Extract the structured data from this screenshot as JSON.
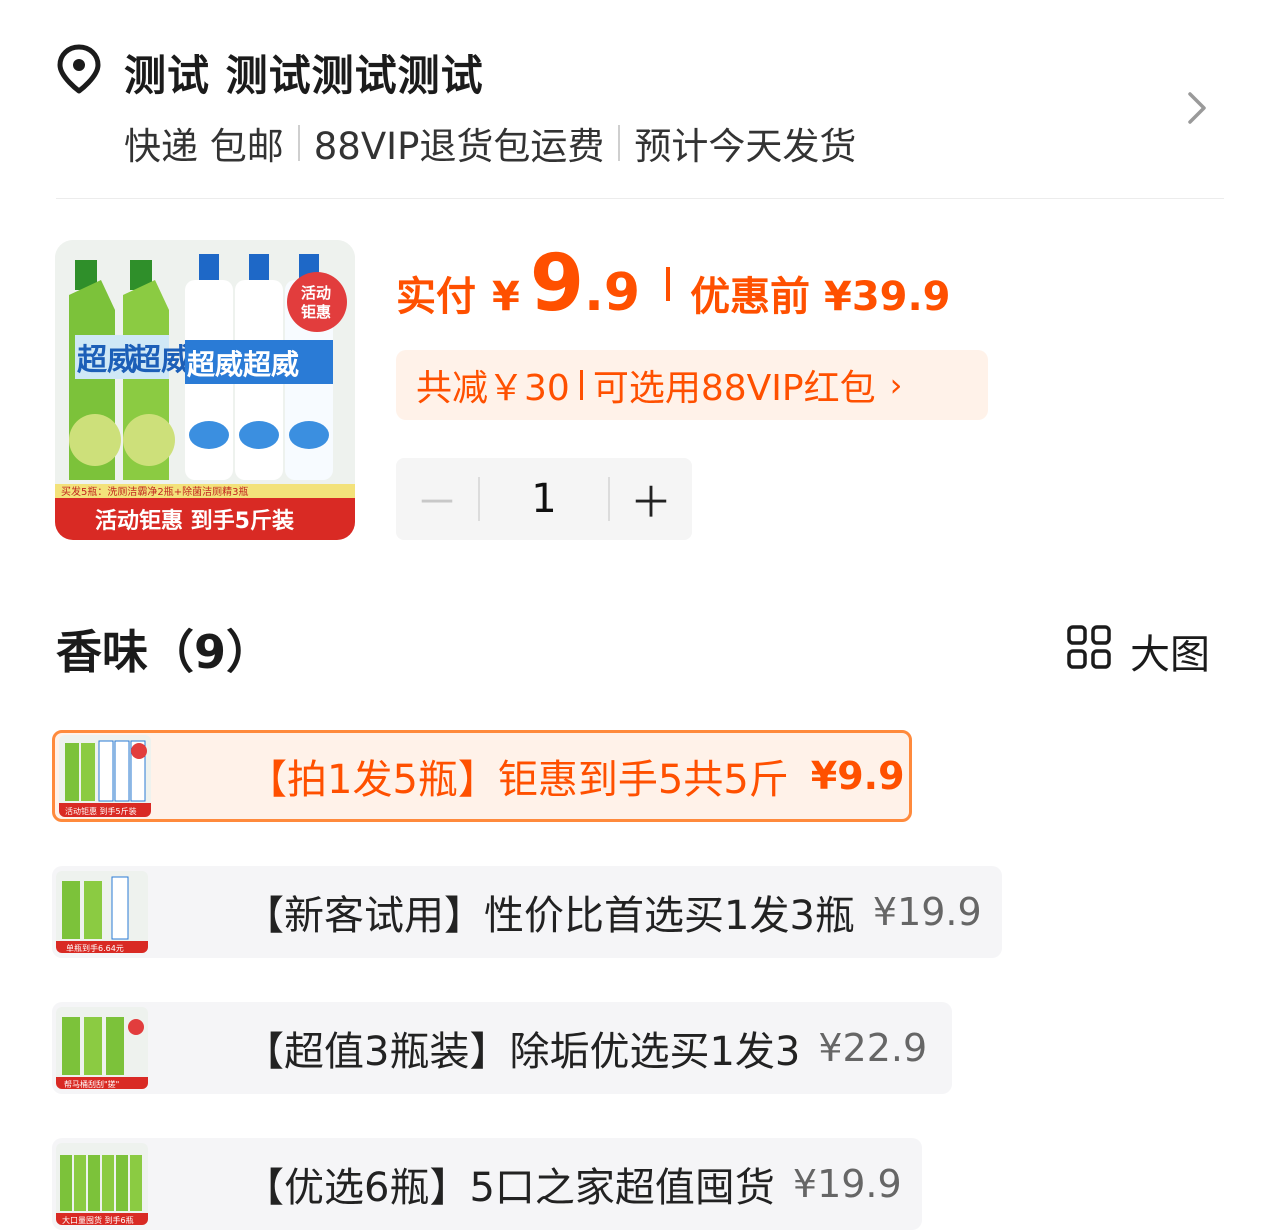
{
  "address": {
    "title": "测试 测试测试测试",
    "shipping": [
      "快递 包邮",
      "88VIP退货包运费",
      "预计今天发货"
    ]
  },
  "product": {
    "thumb_banner": "活动钜惠 到手5斤装",
    "thumb_sticker": "活动钜惠",
    "thumb_strip": "买发5瓶：洗厕洁霸净2瓶+除菌洁厕精3瓶",
    "brand_text": "超威",
    "pay_label": "实付",
    "currency": "¥",
    "price_int": "9",
    "price_dec": ".9",
    "pre_label": "优惠前 ¥39.9",
    "discount_total": "共减￥30",
    "discount_vip": "可选用88VIP红包",
    "discount_arrow": "›"
  },
  "quantity": {
    "minus": "－",
    "value": "1",
    "plus": "＋"
  },
  "section": {
    "title": "香味（9）",
    "big_view": "大图"
  },
  "options": [
    {
      "label": "【拍1发5瓶】钜惠到手5共5斤",
      "price": "¥9.9",
      "selected": true,
      "thumb_caption": "活动钜惠 到手5斤装"
    },
    {
      "label": "【新客试用】性价比首选买1发3瓶",
      "price": "¥19.9",
      "selected": false,
      "thumb_caption": "单瓶到手6.64元"
    },
    {
      "label": "【超值3瓶装】除垢优选买1发3",
      "price": "¥22.9",
      "selected": false,
      "thumb_caption": "帮马桶刮刮\"搓\""
    },
    {
      "label": "【优选6瓶】5口之家超值囤货",
      "price": "¥19.9",
      "selected": false,
      "thumb_caption": "大口量囤货 到手6瓶"
    }
  ],
  "colors": {
    "accent": "#ff5000",
    "pill_bg": "#fff2e9",
    "option_bg": "#f5f5f7",
    "selected_border": "#ff8a3c"
  }
}
